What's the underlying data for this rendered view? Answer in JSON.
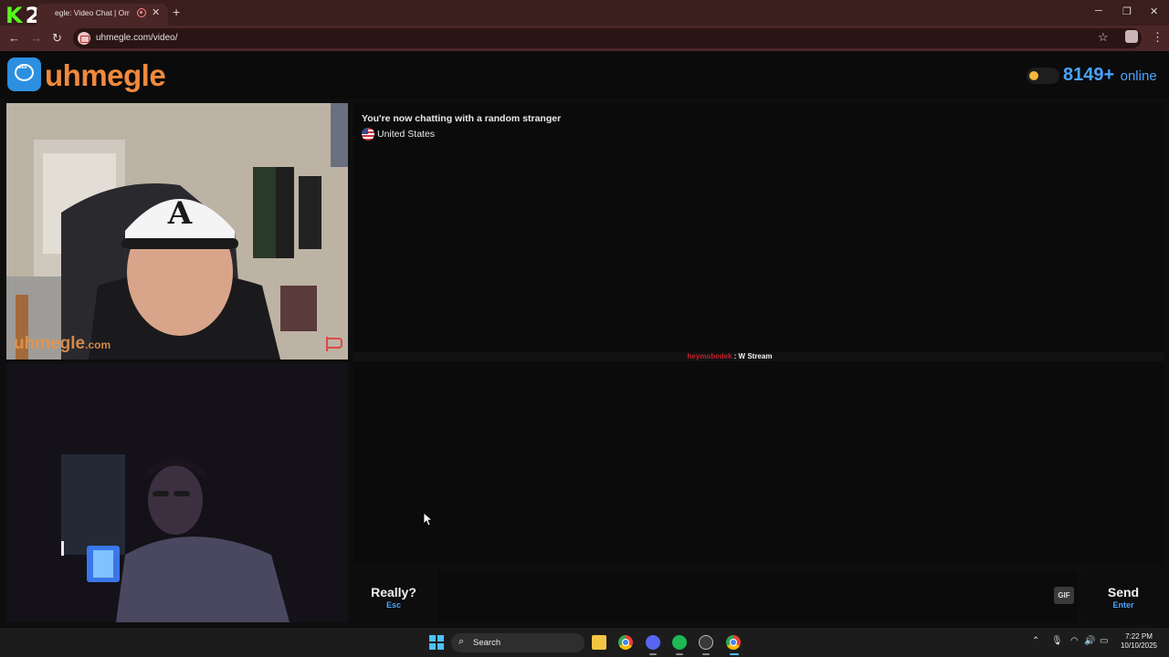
{
  "browser": {
    "logo_k": "K",
    "logo_num": "2",
    "tab_title": "egle: Video Chat | Ome",
    "url": "uhmegle.com/video/",
    "controls": {
      "minimize": "─",
      "restore": "❐",
      "close": "✕",
      "tab_close": "✕",
      "new_tab": "+",
      "back": "←",
      "forward": "→",
      "reload": "↻",
      "star": "☆",
      "menu": "⋮"
    }
  },
  "site": {
    "logo_text": "uhmegle",
    "online_count": "8149+",
    "online_label": "online",
    "toggle_on": false
  },
  "stranger_video": {
    "watermark_main": "uhmegle",
    "watermark_suffix": ".com"
  },
  "chat": {
    "status": "You're now chatting with a random stranger",
    "country": "United States",
    "messages": [
      {
        "user": "heymobedek",
        "separator": " : ",
        "text": "W Stream"
      }
    ]
  },
  "input": {
    "skip_label": "Really?",
    "skip_hint": "Esc",
    "value": "",
    "placeholder": "",
    "gif_label": "GIF",
    "send_label": "Send",
    "send_hint": "Enter"
  },
  "taskbar": {
    "search_label": "Search",
    "time": "7:22 PM",
    "date": "10/10/2025",
    "icons": [
      "windows-start-icon",
      "search-icon",
      "file-explorer-icon",
      "chrome-icon",
      "discord-icon",
      "spotify-icon",
      "vpn-icon",
      "chrome-profile-icon"
    ]
  },
  "colors": {
    "brand_orange": "#f08a3c",
    "accent_blue": "#4aa3ff",
    "username_red": "#c41e2e",
    "tab_bar": "#3a1d1d"
  }
}
